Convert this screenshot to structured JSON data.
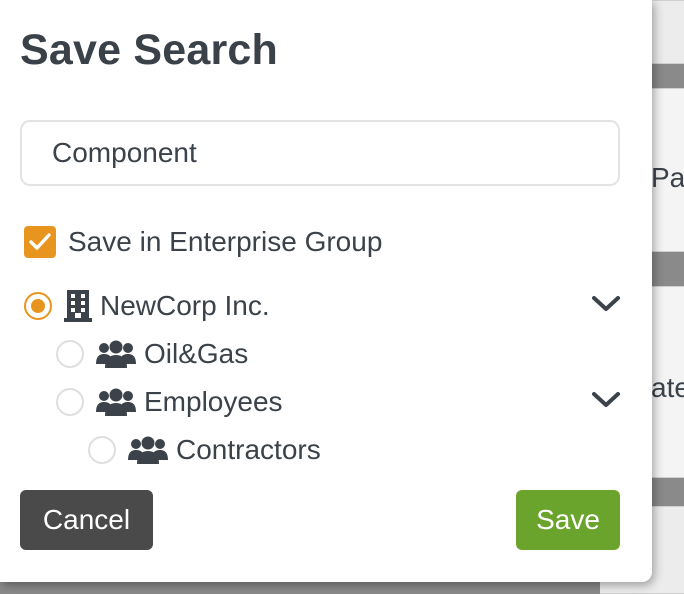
{
  "dialog": {
    "title": "Save Search",
    "search_name": {
      "value": "Component",
      "placeholder": ""
    },
    "enterprise_checkbox": {
      "label": "Save in Enterprise Group",
      "checked": true
    },
    "groups": [
      {
        "label": "NewCorp Inc.",
        "icon": "building-icon",
        "selected": true,
        "expandable": true,
        "level": 0
      },
      {
        "label": "Oil&Gas",
        "icon": "users-icon",
        "selected": false,
        "expandable": false,
        "level": 1
      },
      {
        "label": "Employees",
        "icon": "users-icon",
        "selected": false,
        "expandable": true,
        "level": 1
      },
      {
        "label": "Contractors",
        "icon": "users-icon",
        "selected": false,
        "expandable": false,
        "level": 2
      }
    ],
    "cancel_label": "Cancel",
    "save_label": "Save"
  },
  "background": {
    "fragment_1": "Pa",
    "fragment_2": "ate"
  },
  "colors": {
    "accent": "#e8951f",
    "save": "#6ba42d",
    "cancel": "#4a4a4a",
    "text": "#3b4249"
  }
}
